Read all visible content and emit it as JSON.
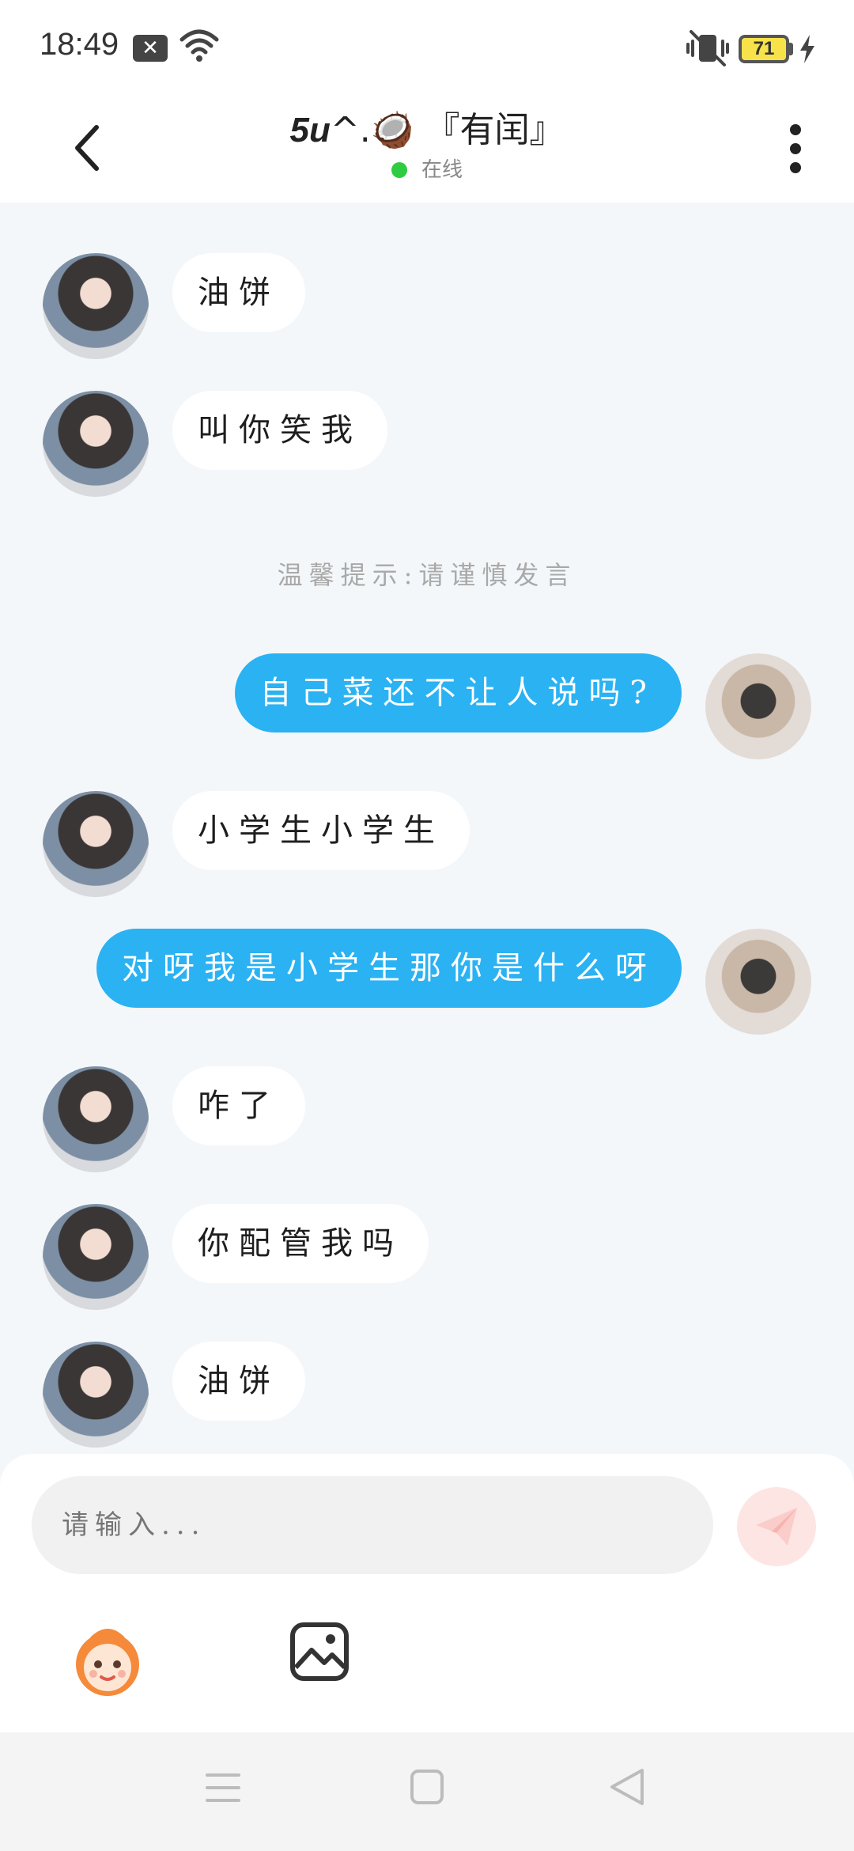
{
  "status_bar": {
    "time": "18:49",
    "battery": "71"
  },
  "header": {
    "title_name": "5u",
    "title_symbols": "^.",
    "title_emoji": "🥥",
    "title_suffix": "『有闰』",
    "status": "在线"
  },
  "messages": [
    {
      "sender": "other",
      "text": "油饼"
    },
    {
      "sender": "other",
      "text": "叫你笑我"
    },
    {
      "sender": "system",
      "text": "温馨提示:请谨慎发言"
    },
    {
      "sender": "self",
      "text": "自己菜还不让人说吗?"
    },
    {
      "sender": "other",
      "text": "小学生小学生"
    },
    {
      "sender": "self",
      "text": "对呀我是小学生那你是什么呀"
    },
    {
      "sender": "other",
      "text": "咋了"
    },
    {
      "sender": "other",
      "text": "你配管我吗"
    },
    {
      "sender": "other",
      "text": "油饼"
    }
  ],
  "input": {
    "placeholder": "请输入..."
  },
  "colors": {
    "self_bubble": "#2ab2f3",
    "other_bubble": "#ffffff",
    "online_dot": "#2ecc40",
    "send_button": "#fde5e4"
  }
}
